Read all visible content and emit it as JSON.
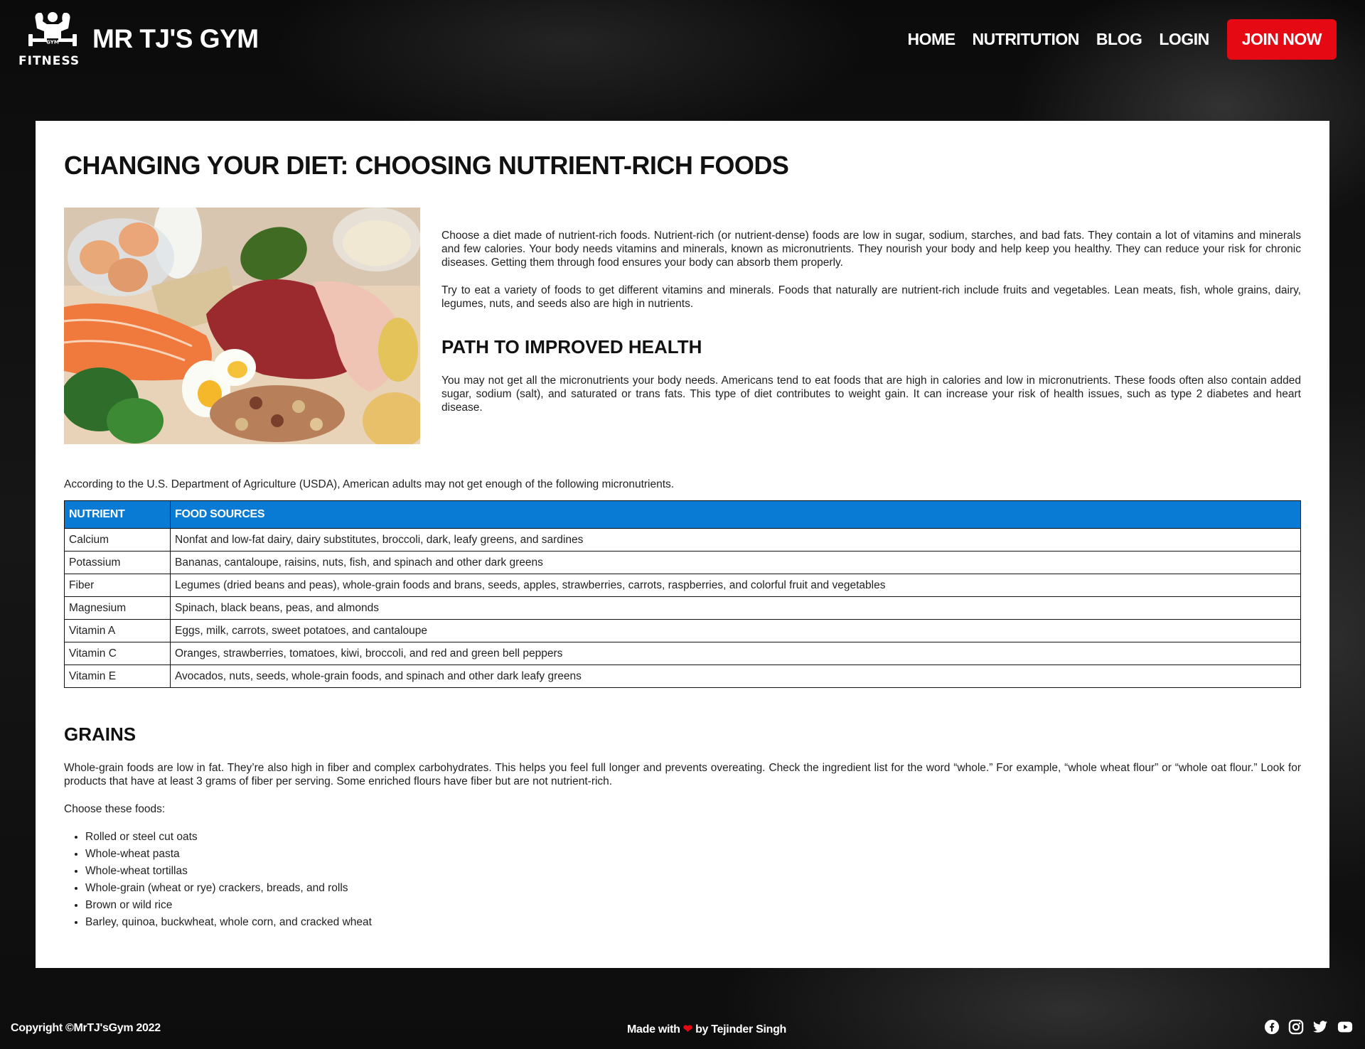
{
  "header": {
    "logo_text": "FITNESS",
    "logo_badge": "GYM",
    "site_title": "MR TJ'S GYM",
    "nav": [
      {
        "label": "HOME"
      },
      {
        "label": "NUTRITUTION"
      },
      {
        "label": "BLOG"
      },
      {
        "label": "LOGIN"
      }
    ],
    "join_label": "JOIN NOW"
  },
  "article": {
    "title": "CHANGING YOUR DIET: CHOOSING NUTRIENT-RICH FOODS",
    "image_alt": "nutrient-rich foods photo",
    "intro_p1": "Choose a diet made of nutrient-rich foods. Nutrient-rich (or nutrient-dense) foods are low in sugar, sodium, starches, and bad fats. They contain a lot of vitamins and minerals and few calories. Your body needs vitamins and minerals, known as micronutrients. They nourish your body and help keep you healthy. They can reduce your risk for chronic diseases. Getting them through food ensures your body can absorb them properly.",
    "intro_p2": "Try to eat a variety of foods to get different vitamins and minerals. Foods that naturally are nutrient-rich include fruits and vegetables. Lean meats, fish, whole grains, dairy, legumes, nuts, and seeds also are high in nutrients.",
    "path_heading": "PATH TO IMPROVED HEALTH",
    "path_p": "You may not get all the micronutrients your body needs. Americans tend to eat foods that are high in calories and low in micronutrients. These foods often also contain added sugar, sodium (salt), and saturated or trans fats. This type of diet contributes to weight gain. It can increase your risk of health issues, such as type 2 diabetes and heart disease.",
    "usda_text": "According to the U.S. Department of Agriculture (USDA), American adults may not get enough of the following micronutrients.",
    "table": {
      "headers": [
        "NUTRIENT",
        "FOOD SOURCES"
      ],
      "rows": [
        [
          "Calcium",
          "Nonfat and low-fat dairy, dairy substitutes, broccoli, dark, leafy greens, and sardines"
        ],
        [
          "Potassium",
          "Bananas, cantaloupe, raisins, nuts, fish, and spinach and other dark greens"
        ],
        [
          "Fiber",
          "Legumes (dried beans and peas), whole-grain foods and brans, seeds, apples, strawberries, carrots, raspberries, and colorful fruit and vegetables"
        ],
        [
          "Magnesium",
          "Spinach, black beans, peas, and almonds"
        ],
        [
          "Vitamin A",
          "Eggs, milk, carrots, sweet potatoes, and cantaloupe"
        ],
        [
          "Vitamin C",
          "Oranges, strawberries, tomatoes, kiwi, broccoli, and red and green bell peppers"
        ],
        [
          "Vitamin E",
          "Avocados, nuts, seeds, whole-grain foods, and spinach and other dark leafy greens"
        ]
      ]
    },
    "grains_heading": "GRAINS",
    "grains_p": "Whole-grain foods are low in fat. They’re also high in fiber and complex carbohydrates. This helps you feel full longer and prevents overeating. Check the ingredient list for the word “whole.” For example, “whole wheat flour” or “whole oat flour.” Look for products that have at least 3 grams of fiber per serving. Some enriched flours have fiber but are not nutrient-rich.",
    "choose_text": "Choose these foods:",
    "foods": [
      "Rolled or steel cut oats",
      "Whole-wheat pasta",
      "Whole-wheat tortillas",
      "Whole-grain (wheat or rye) crackers, breads, and rolls",
      "Brown or wild rice",
      "Barley, quinoa, buckwheat, whole corn, and cracked wheat"
    ]
  },
  "footer": {
    "copyright": "Copyright ©MrTJ'sGym 2022",
    "made_prefix": "Made with",
    "made_suffix": "by Tejinder Singh",
    "social_icons": [
      "facebook-icon",
      "instagram-icon",
      "twitter-icon",
      "youtube-icon"
    ]
  },
  "colors": {
    "accent_red": "#e50914",
    "table_header_blue": "#0a7bd5"
  }
}
